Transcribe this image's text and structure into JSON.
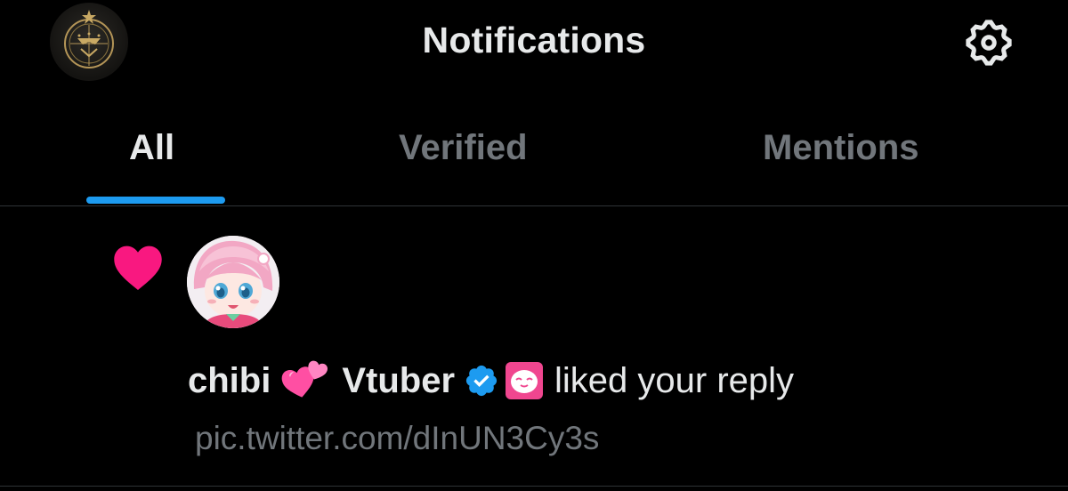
{
  "header": {
    "title": "Notifications",
    "account_avatar": "account-logo",
    "settings_icon": "gear-icon"
  },
  "tabs": [
    {
      "label": "All",
      "active": true
    },
    {
      "label": "Verified",
      "active": false
    },
    {
      "label": "Mentions",
      "active": false
    }
  ],
  "notification": {
    "type_icon": "heart-icon",
    "user_name_part1": "chibi",
    "user_name_emoji": "two-hearts-emoji",
    "user_name_part2": "Vtuber",
    "verified": true,
    "action": "liked your reply",
    "content": "pic.twitter.com/dInUN3Cy3s"
  },
  "colors": {
    "background": "#000000",
    "text_primary": "#e7e9ea",
    "text_secondary": "#71767b",
    "accent": "#1d9bf0",
    "like": "#f91880",
    "divider": "#2f3336"
  }
}
